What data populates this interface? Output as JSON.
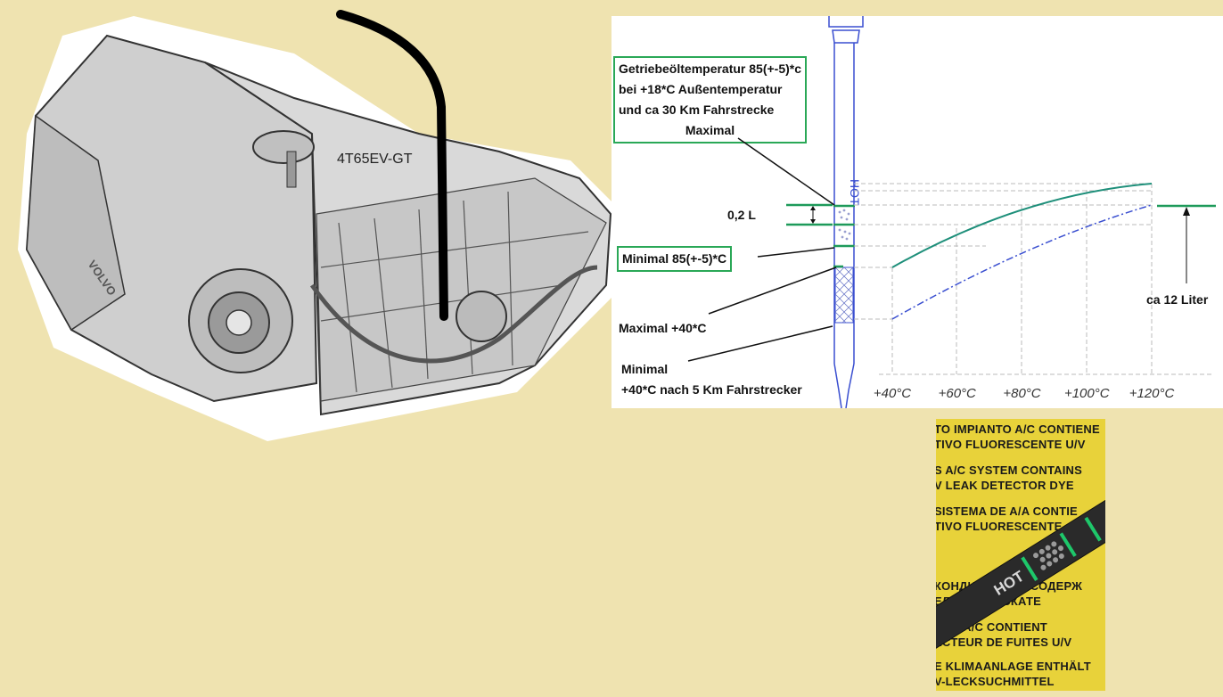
{
  "transmission": {
    "model_label": "4T65EV-GT",
    "brand_logo_text": "VOLVO"
  },
  "callouts": {
    "max_hot": {
      "lines": [
        "Getriebeöltemperatur 85(+-5)*c",
        "bei +18*C Außentemperatur",
        "und ca 30 Km Fahrstrecke",
        "Maximal"
      ]
    },
    "min_hot": {
      "text": "Minimal 85(+-5)*C"
    }
  },
  "labels": {
    "volume_diff": "0,2 L",
    "max_cold": "Maximal +40*C",
    "min_cold_line1": "Minimal",
    "min_cold_line2": "+40*C nach 5 Km Fahrstrecker",
    "capacity": "ca 12 Liter"
  },
  "chart_data": {
    "type": "line",
    "x_ticks": [
      "+40°C",
      "+60°C",
      "+80°C",
      "+100°C",
      "+120°C"
    ],
    "x": [
      40,
      60,
      80,
      100,
      120
    ],
    "series": [
      {
        "color": "#1e8f7a",
        "style": "solid"
      },
      {
        "color": "#3a4fd0",
        "style": "dash-dot"
      }
    ],
    "dipstick_text": "HOT",
    "grid": true
  },
  "photo": {
    "warning_lines": [
      "TO IMPIANTO A/C CONTIENE",
      "TIVO FLUORESCENTE U/V",
      "S A/C SYSTEM CONTAINS",
      "V LEAK DETECTOR DYE",
      "SISTEMA DE A/A CONTIE",
      "TIVO FLUORESCENTE",
      "КОНДИЦИОНЕР СОДЕРЖ",
      "ЕЛЬ ТЕЧЕИСКАТЕ",
      "ÈME A/C CONTIENT",
      "ECTEUR DE FUITES U/V",
      "E KLIMAANLAGE ENTHÄLT",
      "V-LECKSUCHMITTEL"
    ],
    "dipstick_text": "HOT"
  }
}
